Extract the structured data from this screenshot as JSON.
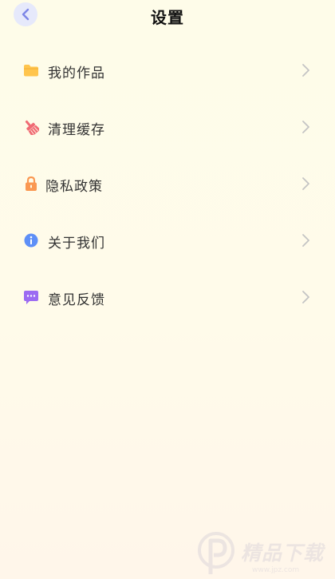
{
  "header": {
    "title": "设置"
  },
  "menu": {
    "items": [
      {
        "label": "我的作品",
        "icon": "folder-icon",
        "color": "#ffc54d"
      },
      {
        "label": "清理缓存",
        "icon": "broom-icon",
        "color": "#f06b74"
      },
      {
        "label": "隐私政策",
        "icon": "lock-icon",
        "color": "#fa9852"
      },
      {
        "label": "关于我们",
        "icon": "info-icon",
        "color": "#5e8ff7"
      },
      {
        "label": "意见反馈",
        "icon": "chat-bubble-icon",
        "color": "#9c6bf2"
      }
    ]
  },
  "theme": {
    "back_button_bg": "#e6e9fb",
    "back_arrow": "#7d86e6",
    "chevron": "#c4c4c4",
    "background": "#fefce9"
  },
  "watermark": {
    "text": "精品下载",
    "url": "www.jpz.com"
  }
}
